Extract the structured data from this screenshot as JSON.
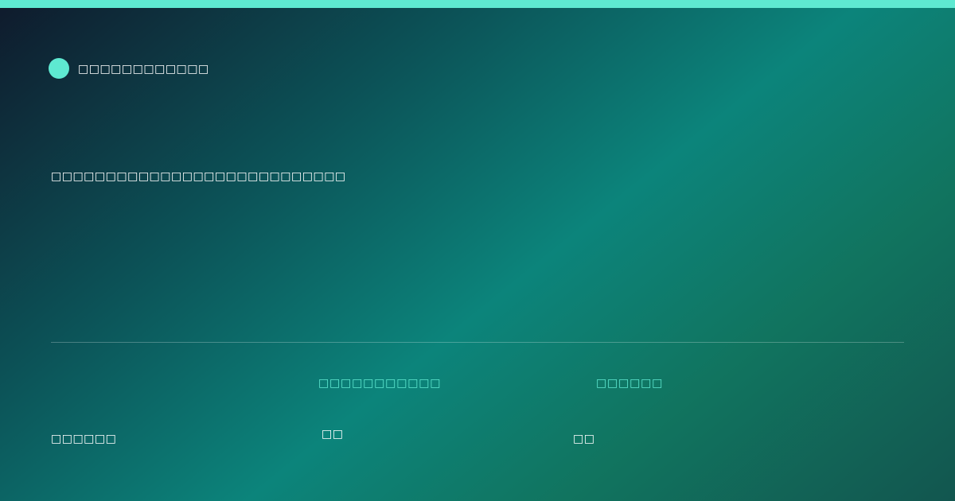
{
  "colors": {
    "accent": "#5ee9d1",
    "text": "#ffffff",
    "bg_dark": "#0f1a2c",
    "bg_teal": "#0c847b"
  },
  "brand": {
    "name": "□□□□□□□□□□□□"
  },
  "headline": "□□□□□□□□□□□□□□□□□□□□□□□□□□□",
  "meta": {
    "author_value": "□□□□□□",
    "items": [
      {
        "label": "□□□□□□□□□□□",
        "value": "□□"
      },
      {
        "label": "□□□□□□",
        "value": "□□"
      }
    ]
  }
}
